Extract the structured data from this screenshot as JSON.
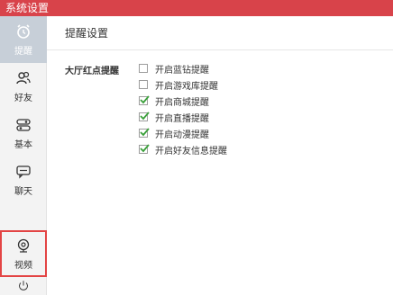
{
  "window": {
    "title": "系统设置"
  },
  "sidebar": {
    "items": [
      {
        "label": "提醒",
        "icon": "alarm-clock-icon",
        "active": true
      },
      {
        "label": "好友",
        "icon": "users-icon",
        "active": false
      },
      {
        "label": "基本",
        "icon": "toggle-settings-icon",
        "active": false
      },
      {
        "label": "聊天",
        "icon": "chat-bubble-icon",
        "active": false
      },
      {
        "label": "视频",
        "icon": "webcam-icon",
        "active": false,
        "highlighted": true
      },
      {
        "label": "",
        "icon": "power-icon",
        "active": false
      }
    ]
  },
  "main": {
    "title": "提醒设置",
    "group_label": "大厅红点提醒",
    "options": [
      {
        "label": "开启蓝钻提醒",
        "checked": false
      },
      {
        "label": "开启游戏库提醒",
        "checked": false
      },
      {
        "label": "开启商城提醒",
        "checked": true
      },
      {
        "label": "开启直播提醒",
        "checked": true
      },
      {
        "label": "开启动漫提醒",
        "checked": true
      },
      {
        "label": "开启好友信息提醒",
        "checked": true
      }
    ]
  },
  "colors": {
    "titlebar": "#d8434a",
    "active_nav": "#c7cfd8",
    "check": "#3aa03a",
    "highlight_border": "#e34444"
  }
}
